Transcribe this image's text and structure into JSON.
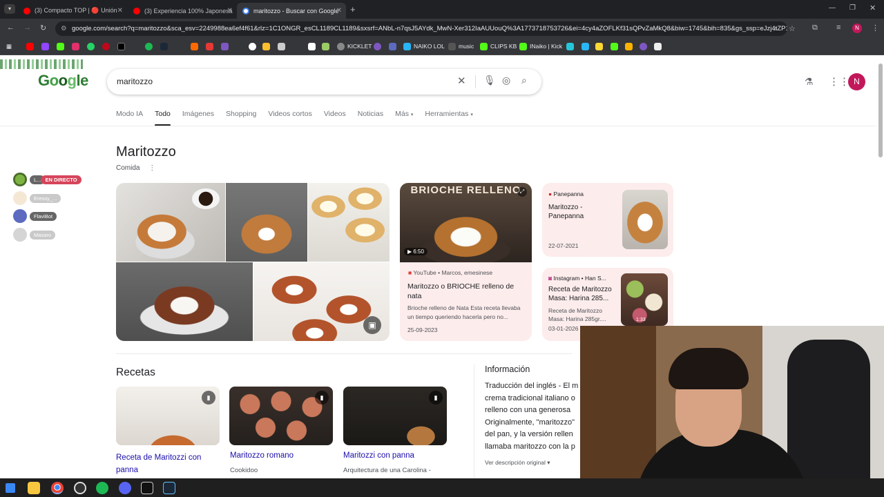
{
  "browser": {
    "tabs": [
      {
        "title": "(3) Compacto TOP | 🔴 Unión"
      },
      {
        "title": "(3) Experiencia 100% Japonesa"
      },
      {
        "title": "maritozzo - Buscar con Google"
      }
    ],
    "new_tab": "+",
    "url": "google.com/search?q=maritozzo&sca_esv=2249988ea6ef4f61&rlz=1C1ONGR_esCL1189CL1189&sxsrf=ANbL-n7qsJ5AYdk_MwN-Xer312IaAUUouQ%3A1773718753726&ei=4cy4aZOFLKf31sQPvZaMkQ8&biw=1745&bih=835&gs_ssp=eJzj4tZP1...",
    "profile_initial": "N",
    "bookmarks": [
      "KICKLET",
      "NAIKO LOL",
      "music",
      "CLIPS KB",
      "INaiko | Kick"
    ]
  },
  "search": {
    "query": "maritozzo",
    "tabs": [
      "Modo IA",
      "Todo",
      "Imágenes",
      "Shopping",
      "Videos cortos",
      "Videos",
      "Noticias",
      "Más",
      "Herramientas"
    ],
    "active_tab": "Todo",
    "profile_initial": "N"
  },
  "knowledge": {
    "title": "Maritozzo",
    "subtitle": "Comida"
  },
  "video_card": {
    "thumb_text": "BRIOCHE RELLENO",
    "duration": "6:50",
    "source": "YouTube • Marcos, emesinese",
    "title": "Maritozzo o BRIOCHE relleno de nata",
    "snippet": "Brioche relleno de Nata Esta receta llevaba un tiempo queriendo hacerla pero no...",
    "date": "25-09-2023"
  },
  "side_cards": [
    {
      "source": "Panepanna",
      "title": "Maritozzo - Panepanna",
      "date": "22-07-2021"
    },
    {
      "source": "Instagram • Han S...",
      "title": "Receta de Maritozzo Masa: Harina 285...",
      "snippet": "Receta de Maritozzo Masa: Harina 285gr....",
      "date": "03-01-2026",
      "duration": "1:33"
    }
  ],
  "recipes": {
    "heading": "Recetas",
    "items": [
      {
        "title": "Receta de Maritozzi con panna",
        "source": ""
      },
      {
        "title": "Maritozzo romano",
        "source": "Cookidoo"
      },
      {
        "title": "Maritozzi con panna",
        "source": "Arquitectura de una Carolina -"
      }
    ]
  },
  "info": {
    "heading": "Información",
    "lines": [
      "Traducción del inglés - El m",
      "crema tradicional italiano o",
      "relleno con una generosa",
      "Originalmente, \"maritozzo\"",
      "del pan, y la versión rellen",
      "llamaba maritozzo con la p"
    ],
    "more": "Ver descripción original"
  },
  "chat_overlay": [
    {
      "name": "L...",
      "badge": "EN DIRECTO"
    },
    {
      "name": "Eressy_..."
    },
    {
      "name": "FlaviBot"
    },
    {
      "name": "Masaro"
    }
  ],
  "colors": {
    "accent": "#1a0dab",
    "card_bg": "#fdecec",
    "live_badge": "#d6455a"
  }
}
